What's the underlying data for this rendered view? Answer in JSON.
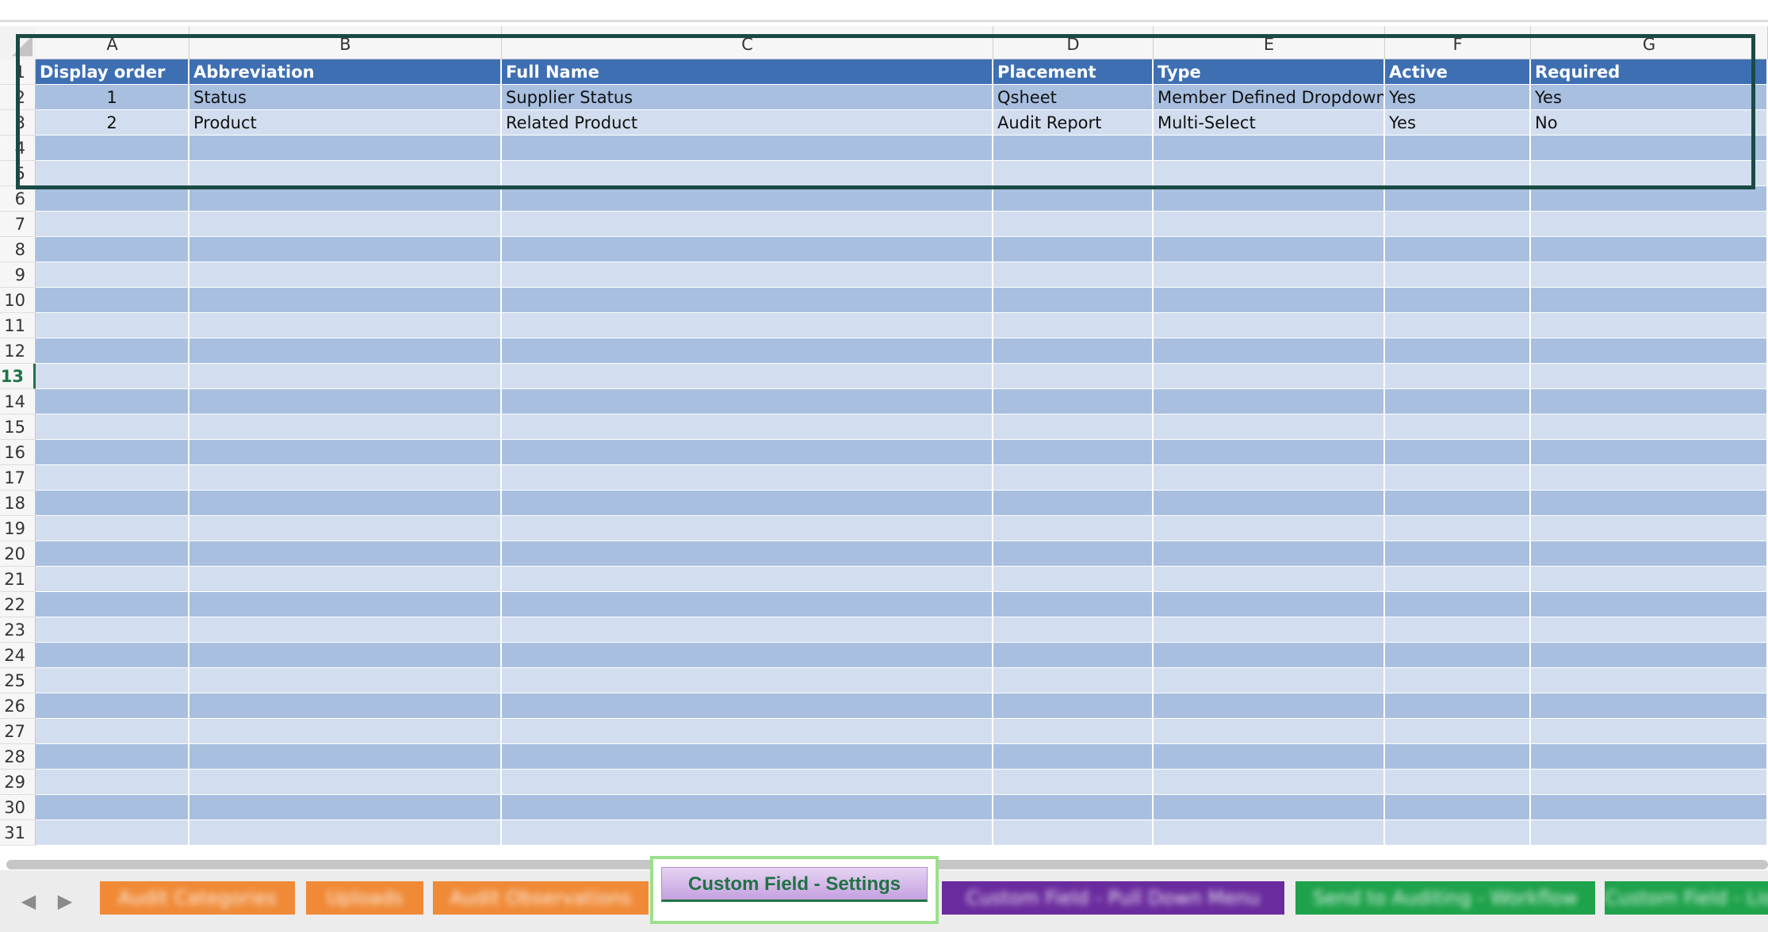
{
  "columns": [
    "A",
    "B",
    "C",
    "D",
    "E",
    "F",
    "G"
  ],
  "row_numbers": [
    "1",
    "2",
    "3",
    "4",
    "5",
    "6",
    "7",
    "8",
    "9",
    "10",
    "11",
    "12",
    "13",
    "14",
    "15",
    "16",
    "17",
    "18",
    "19",
    "20",
    "21",
    "22",
    "23",
    "24",
    "25",
    "26",
    "27",
    "28",
    "29",
    "30",
    "31"
  ],
  "selected_row": "13",
  "table": {
    "headers": [
      "Display order",
      "Abbreviation",
      "Full Name",
      "Placement",
      "Type",
      "Active",
      "Required"
    ],
    "rows": [
      [
        "1",
        "Status",
        "Supplier Status",
        "Qsheet",
        "Member Defined Dropdown",
        "Yes",
        "Yes"
      ],
      [
        "2",
        "Product",
        "Related Product",
        "Audit Report",
        "Multi-Select",
        "Yes",
        "No"
      ]
    ]
  },
  "sheet_tabs": {
    "active": "Custom Field - Settings",
    "others_blurred": [
      "Audit Categories",
      "Uploads",
      "Audit Observations",
      "Custom Field - Pull Down Menu",
      "Send to Auditing - Workflow",
      "Custom Field - Lists"
    ]
  },
  "colors": {
    "header_fill": "#3e6fb3",
    "band_dark": "#a8bfe0",
    "band_light": "#d2deef",
    "highlight_border": "#1b4a45",
    "active_tab_border": "#9be08c",
    "excel_green": "#1f7244"
  }
}
